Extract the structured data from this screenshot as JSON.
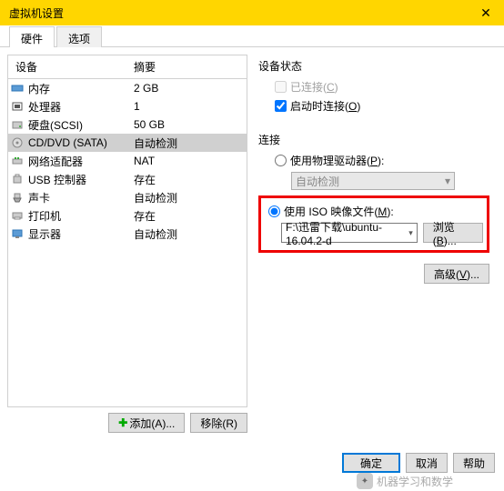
{
  "window": {
    "title": "虚拟机设置",
    "close": "✕"
  },
  "tabs": {
    "hardware": "硬件",
    "options": "选项"
  },
  "device_list": {
    "header_device": "设备",
    "header_summary": "摘要",
    "rows": [
      {
        "name": "内存",
        "summary": "2 GB"
      },
      {
        "name": "处理器",
        "summary": "1"
      },
      {
        "name": "硬盘(SCSI)",
        "summary": "50 GB"
      },
      {
        "name": "CD/DVD (SATA)",
        "summary": "自动检测"
      },
      {
        "name": "网络适配器",
        "summary": "NAT"
      },
      {
        "name": "USB 控制器",
        "summary": "存在"
      },
      {
        "name": "声卡",
        "summary": "自动检测"
      },
      {
        "name": "打印机",
        "summary": "存在"
      },
      {
        "name": "显示器",
        "summary": "自动检测"
      }
    ]
  },
  "left_buttons": {
    "add": "添加(A)...",
    "remove": "移除(R)"
  },
  "right": {
    "status_title": "设备状态",
    "connected": "已连接(C)",
    "connect_on_power": "启动时连接(O)",
    "connection_title": "连接",
    "use_physical": "使用物理驱动器(P):",
    "auto_detect": "自动检测",
    "use_iso": "使用 ISO 映像文件(M):",
    "iso_path": "F:\\迅雷下载\\ubuntu-16.04.2-d",
    "browse": "浏览(B)...",
    "advanced": "高级(V)..."
  },
  "bottom": {
    "ok": "确定",
    "cancel": "取消",
    "help": "帮助"
  },
  "watermark": {
    "text": "机器学习和数学"
  }
}
